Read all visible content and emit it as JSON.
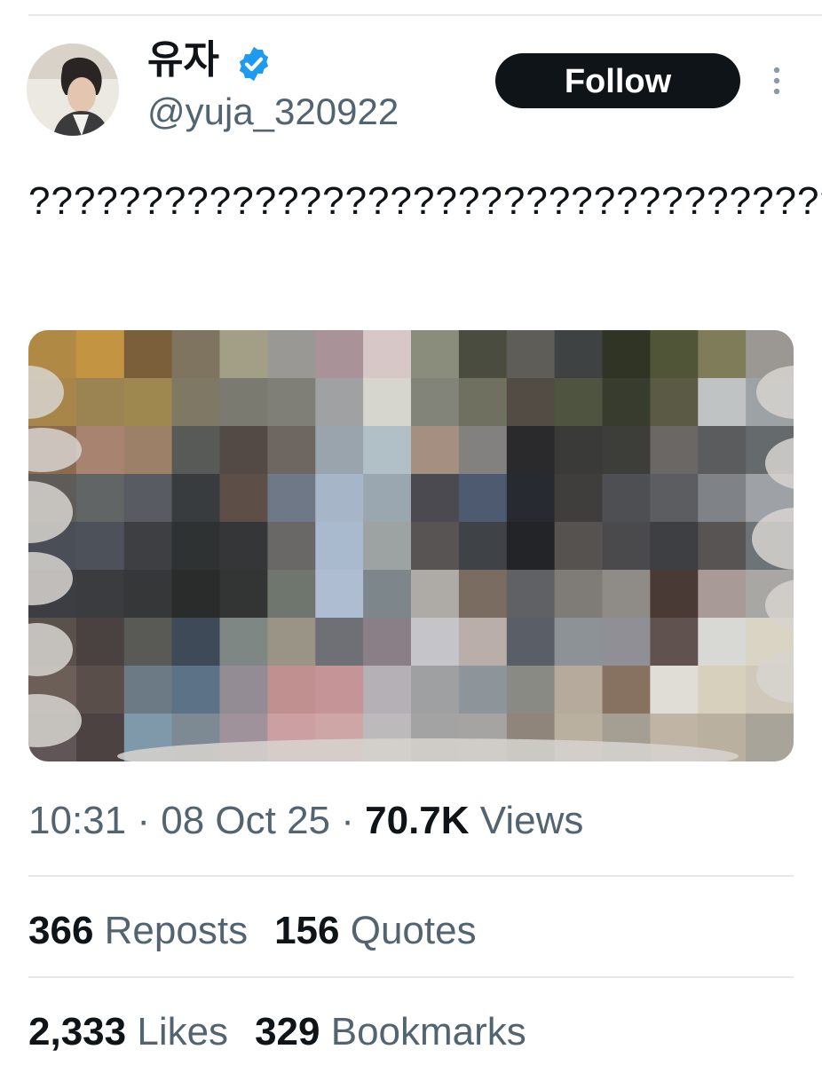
{
  "user": {
    "display_name": "유자",
    "handle": "@yuja_320922",
    "verified": true,
    "avatar": "profile-photo"
  },
  "actions": {
    "follow_label": "Follow",
    "more_icon": "more-vertical-icon"
  },
  "tweet": {
    "text": "????????????????????????????????????",
    "media": "pixelated-photo"
  },
  "meta": {
    "time": "10:31",
    "sep1": "·",
    "date": "08 Oct 25",
    "sep2": "·",
    "views_count": "70.7K",
    "views_label": "Views"
  },
  "stats": {
    "reposts_count": "366",
    "reposts_label": "Reposts",
    "quotes_count": "156",
    "quotes_label": "Quotes",
    "likes_count": "2,333",
    "likes_label": "Likes",
    "bookmarks_count": "329",
    "bookmarks_label": "Bookmarks"
  },
  "colors": {
    "text": "#0f1419",
    "secondary": "#536471",
    "verified_blue": "#1d9bf0",
    "divider": "#e6e8ea"
  }
}
